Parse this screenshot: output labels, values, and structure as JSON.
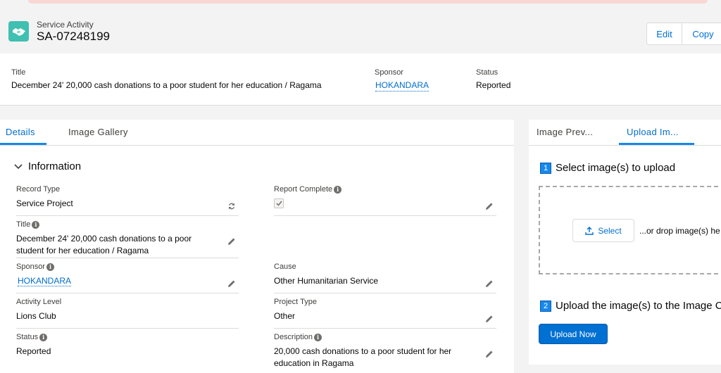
{
  "header": {
    "object_label": "Service Activity",
    "record_name": "SA-07248199",
    "icon": "handshake-icon",
    "icon_color": "#3fc0b1",
    "actions": {
      "edit": "Edit",
      "copy": "Copy"
    }
  },
  "highlights": {
    "title_label": "Title",
    "title_value": "December 24' 20,000 cash donations to a poor student for her education / Ragama",
    "sponsor_label": "Sponsor",
    "sponsor_value": "HOKANDARA",
    "status_label": "Status",
    "status_value": "Reported"
  },
  "left_tabs": [
    "Details",
    "Image Gallery"
  ],
  "section": {
    "title": "Information"
  },
  "fields": {
    "record_type": {
      "label": "Record Type",
      "value": "Service Project"
    },
    "report_complete": {
      "label": "Report Complete",
      "checked": true
    },
    "title": {
      "label": "Title",
      "value_line1": "December 24' 20,000 cash donations to a poor",
      "value_line2": "student for her education / Ragama"
    },
    "sponsor": {
      "label": "Sponsor",
      "value": "HOKANDARA"
    },
    "cause": {
      "label": "Cause",
      "value": "Other Humanitarian Service"
    },
    "activity_level": {
      "label": "Activity Level",
      "value": "Lions Club"
    },
    "project_type": {
      "label": "Project Type",
      "value": "Other"
    },
    "status": {
      "label": "Status",
      "value": "Reported"
    },
    "description": {
      "label": "Description",
      "value_line1": "20,000 cash donations to a poor student for her",
      "value_line2": "education in Ragama"
    }
  },
  "right_tabs": [
    "Image Prev...",
    "Upload Im..."
  ],
  "upload": {
    "step1_num": "1",
    "step1_text": "Select image(s) to upload",
    "select_label": "Select",
    "drop_text": "...or drop image(s) he",
    "step2_num": "2",
    "step2_text": "Upload the image(s) to the Image C",
    "upload_now": "Upload Now"
  },
  "colors": {
    "brand": "#0070d2",
    "link": "#006dcc",
    "tab_active": "#1589ee",
    "page_bg": "#f3f3f3"
  }
}
